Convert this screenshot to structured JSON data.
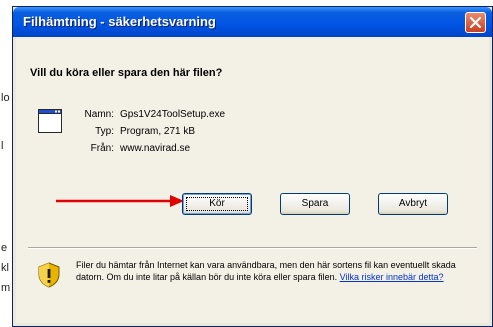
{
  "background": {
    "fragments": [
      "lo",
      "l",
      "e",
      "kl",
      "m"
    ]
  },
  "dialog": {
    "title": "Filhämtning - säkerhetsvarning",
    "question": "Vill du köra eller spara den här filen?",
    "file": {
      "name_label": "Namn:",
      "name_value": "Gps1V24ToolSetup.exe",
      "type_label": "Typ:",
      "type_value": "Program, 271 kB",
      "from_label": "Från:",
      "from_value": "www.navirad.se"
    },
    "buttons": {
      "run": "Kör",
      "save": "Spara",
      "cancel": "Avbryt"
    },
    "warning": {
      "text": "Filer du hämtar från Internet kan vara användbara, men den här sortens fil kan eventuellt skada datorn. Om du inte litar på källan bör du inte köra eller spara filen.",
      "link": "Vilka risker innebär detta?"
    }
  },
  "colors": {
    "titlebar": "#0054e3",
    "arrow": "#e00000",
    "link": "#0033cc"
  },
  "icons": [
    "close-icon",
    "program-file-icon",
    "warning-shield-icon",
    "red-arrow-annotation"
  ]
}
